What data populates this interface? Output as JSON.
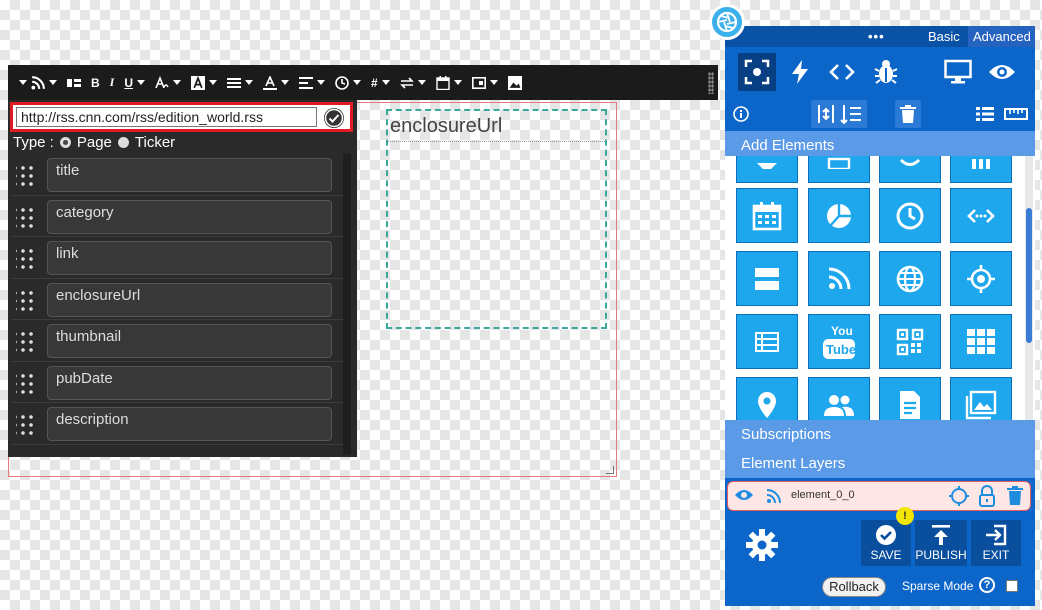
{
  "colors": {
    "panel_bg": "#0c66c9",
    "tile": "#1ea7ec",
    "toolbar_bg": "#1b1b1b",
    "rss_panel_bg": "#2a2a2a",
    "url_highlight": "#e01b24",
    "section_head": "#5b9ae6"
  },
  "canvas": {
    "enclosure_label": "enclosureUrl"
  },
  "toolbar": {
    "items": [
      "rss-icon",
      "layout-icon",
      "bold-icon",
      "italic-icon",
      "underline-icon",
      "text-style-icon",
      "text-bg-icon",
      "list-icon",
      "font-color-icon",
      "align-icon",
      "clock-icon",
      "hash-icon",
      "swap-icon",
      "calendar-icon",
      "frame-icon",
      "image-icon"
    ],
    "bold_label": "B",
    "italic_label": "I",
    "underline_label": "U",
    "hash_label": "#"
  },
  "rss": {
    "url": "http://rss.cnn.com/rss/edition_world.rss",
    "type_label": "Type :",
    "type_options": [
      "Page",
      "Ticker"
    ],
    "type_selected": "Page",
    "fields": [
      "title",
      "category",
      "link",
      "enclosureUrl",
      "thumbnail",
      "pubDate",
      "description"
    ]
  },
  "panel": {
    "dots": "•••",
    "basic_label": "Basic",
    "advanced_label": "Advanced",
    "add_elements": "Add Elements",
    "subscriptions": "Subscriptions",
    "element_layers": "Element Layers",
    "layer_name": "element_0_0",
    "save_label": "SAVE",
    "publish_label": "PUBLISH",
    "exit_label": "EXIT",
    "warn_badge": "!",
    "rollback_label": "Rollback",
    "sparse_mode_label": "Sparse Mode",
    "help_mark": "?",
    "tiles": [
      "partial-tile",
      "partial-tile",
      "partial-tile",
      "partial-tile",
      "calendar-icon",
      "pie-chart-icon",
      "clock-icon",
      "code-icon",
      "layout-icon",
      "rss-icon",
      "globe-icon",
      "target-icon",
      "list-icon",
      "youtube-icon",
      "qr-code-icon",
      "grid-icon",
      "map-pin-icon",
      "users-icon",
      "document-icon",
      "gallery-icon"
    ],
    "youtube_top": "You",
    "youtube_bottom": "Tube"
  }
}
